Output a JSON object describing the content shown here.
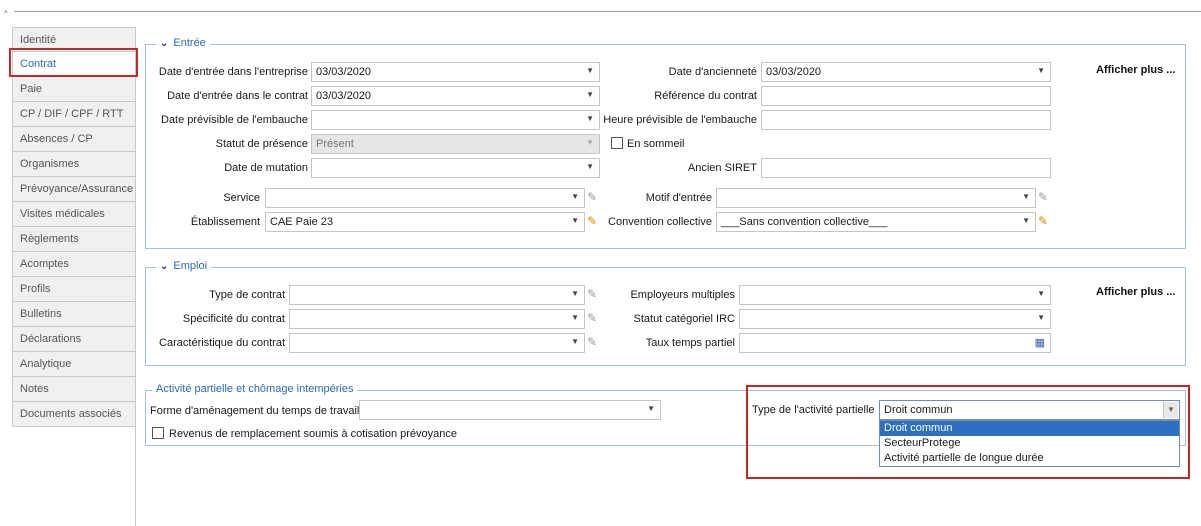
{
  "sidebar": {
    "items": [
      {
        "label": "Identité"
      },
      {
        "label": "Contrat"
      },
      {
        "label": "Paie"
      },
      {
        "label": "CP / DIF / CPF / RTT"
      },
      {
        "label": "Absences / CP"
      },
      {
        "label": "Organismes"
      },
      {
        "label": "Prévoyance/Assurance"
      },
      {
        "label": "Visites médicales"
      },
      {
        "label": "Règlements"
      },
      {
        "label": "Acomptes"
      },
      {
        "label": "Profils"
      },
      {
        "label": "Bulletins"
      },
      {
        "label": "Déclarations"
      },
      {
        "label": "Analytique"
      },
      {
        "label": "Notes"
      },
      {
        "label": "Documents associés"
      }
    ]
  },
  "entree": {
    "title": "Entrée",
    "more": "Afficher plus ...",
    "date_entree_entreprise": {
      "label": "Date d'entrée dans l'entreprise",
      "value": "03/03/2020"
    },
    "date_entree_contrat": {
      "label": "Date d'entrée dans le contrat",
      "value": "03/03/2020"
    },
    "date_previsible": {
      "label": "Date prévisible de l'embauche",
      "value": ""
    },
    "statut_presence": {
      "label": "Statut de présence",
      "value": "Présent"
    },
    "date_mutation": {
      "label": "Date de mutation",
      "value": ""
    },
    "service": {
      "label": "Service",
      "value": ""
    },
    "etablissement": {
      "label": "Établissement",
      "value": "CAE Paie 23"
    },
    "date_anciennete": {
      "label": "Date d'ancienneté",
      "value": "03/03/2020"
    },
    "reference_contrat": {
      "label": "Référence du contrat",
      "value": ""
    },
    "heure_previsible": {
      "label": "Heure prévisible de l'embauche",
      "value": ""
    },
    "en_sommeil": {
      "label": "En sommeil"
    },
    "ancien_siret": {
      "label": "Ancien SIRET",
      "value": ""
    },
    "motif_entree": {
      "label": "Motif d'entrée",
      "value": ""
    },
    "convention": {
      "label": "Convention collective",
      "value": "___Sans convention collective___"
    }
  },
  "emploi": {
    "title": "Emploi",
    "more": "Afficher plus ...",
    "type_contrat": {
      "label": "Type de contrat",
      "value": ""
    },
    "specificite": {
      "label": "Spécificité du contrat",
      "value": ""
    },
    "caracteristique": {
      "label": "Caractéristique du contrat",
      "value": ""
    },
    "employeurs_multiples": {
      "label": "Employeurs multiples",
      "value": ""
    },
    "statut_irc": {
      "label": "Statut catégoriel IRC",
      "value": ""
    },
    "taux_temps_partiel": {
      "label": "Taux temps partiel",
      "value": ""
    }
  },
  "activite": {
    "title": "Activité partielle et chômage intempéries",
    "forme": {
      "label": "Forme d'aménagement du temps de travail",
      "value": ""
    },
    "revenus": {
      "label": "Revenus de remplacement soumis à cotisation prévoyance"
    },
    "type_activite": {
      "label": "Type de l'activité partielle",
      "value": "Droit commun"
    },
    "options": [
      "Droit commun",
      "SecteurProtege",
      "Activité partielle de longue durée"
    ]
  }
}
